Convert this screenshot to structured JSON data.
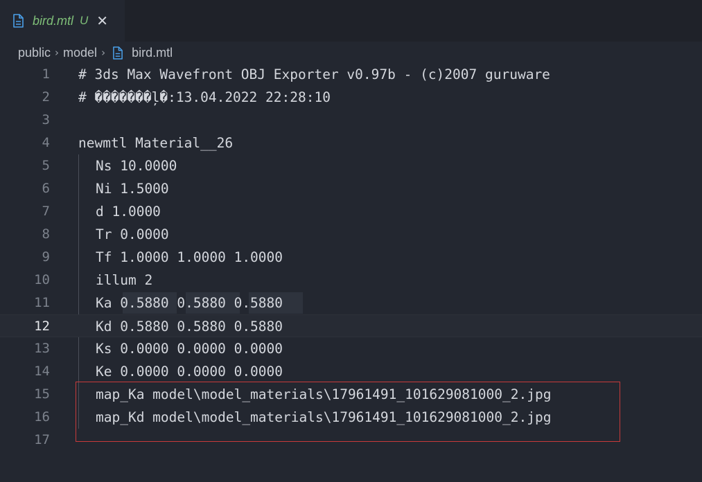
{
  "tab": {
    "filename": "bird.mtl",
    "status": "U",
    "close_glyph": "✕"
  },
  "breadcrumb": {
    "items": [
      "public",
      "model",
      "bird.mtl"
    ],
    "separator": "›"
  },
  "editor": {
    "current_line": 12,
    "lines": [
      {
        "no": "1",
        "text": "# 3ds Max Wavefront OBJ Exporter v0.97b - (c)2007 guruware"
      },
      {
        "no": "2",
        "text": "# �������ļ�:13.04.2022 22:28:10"
      },
      {
        "no": "3",
        "text": ""
      },
      {
        "no": "4",
        "text": "newmtl Material__26"
      },
      {
        "no": "5",
        "text": "Ns 10.0000"
      },
      {
        "no": "6",
        "text": "Ni 1.5000"
      },
      {
        "no": "7",
        "text": "d 1.0000"
      },
      {
        "no": "8",
        "text": "Tr 0.0000"
      },
      {
        "no": "9",
        "text": "Tf 1.0000 1.0000 1.0000"
      },
      {
        "no": "10",
        "text": "illum 2"
      },
      {
        "no": "11",
        "text": "Ka 0.5880 0.5880 0.5880"
      },
      {
        "no": "12",
        "text": "Kd 0.5880 0.5880 0.5880"
      },
      {
        "no": "13",
        "text": "Ks 0.0000 0.0000 0.0000"
      },
      {
        "no": "14",
        "text": "Ke 0.0000 0.0000 0.0000"
      },
      {
        "no": "15",
        "text": "map_Ka model\\model_materials\\17961491_101629081000_2.jpg"
      },
      {
        "no": "16",
        "text": "map_Kd model\\model_materials\\17961491_101629081000_2.jpg"
      },
      {
        "no": "17",
        "text": ""
      }
    ]
  },
  "colors": {
    "background": "#232730",
    "tab_text": "#7fbf78",
    "file_icon": "#4a9fe8",
    "highlight_border": "#c93a3a"
  },
  "icons": {
    "tab_file": "file-icon",
    "crumb_file": "file-icon",
    "close": "close-icon"
  }
}
